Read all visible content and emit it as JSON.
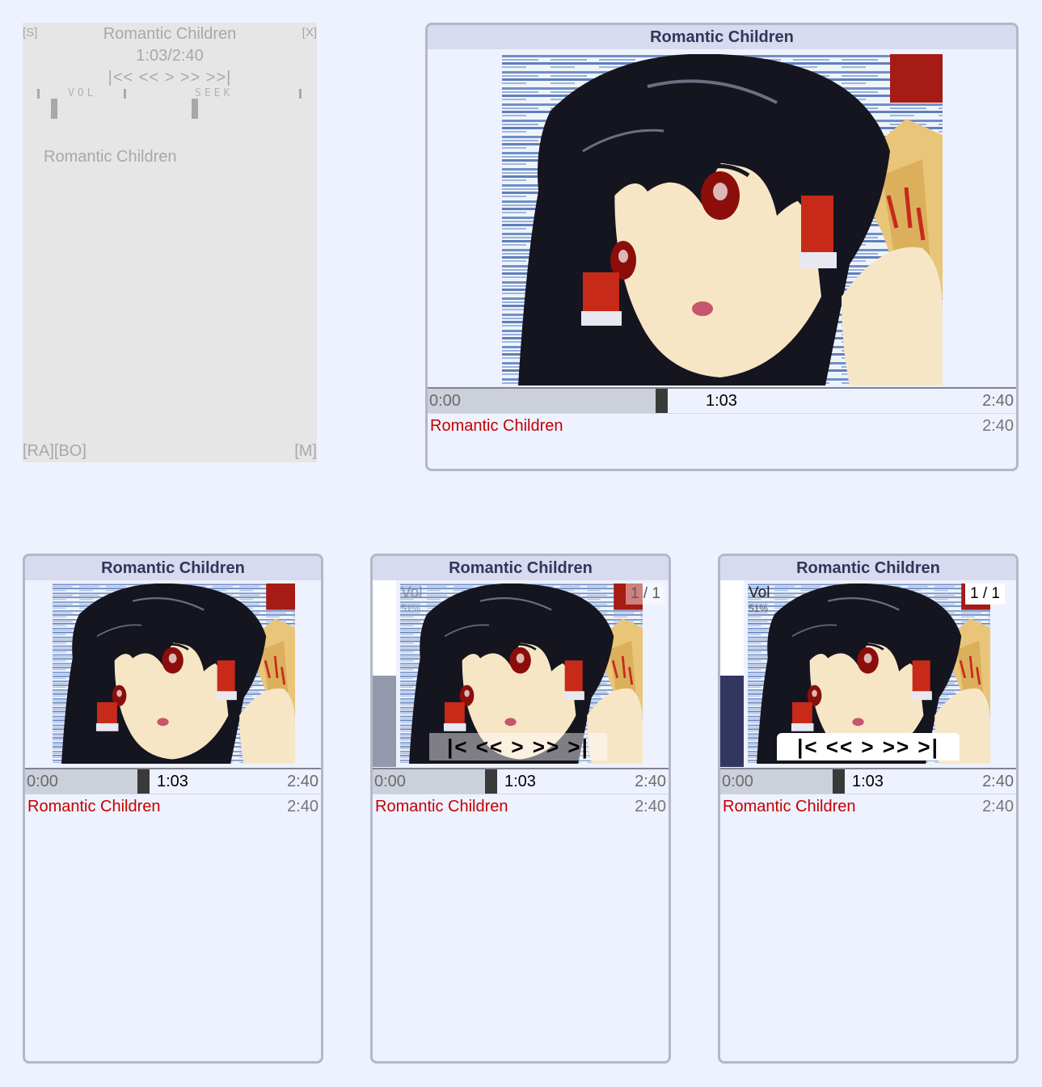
{
  "simple_player": {
    "btn_s": "[S]",
    "btn_x": "[X]",
    "title": "Romantic Children",
    "time": "1:03/2:40",
    "controls": "|<< << > >> >>|",
    "vol_label": "VOL",
    "seek_label": "SEEK",
    "track": "Romantic Children",
    "btn_ra_bo": "[RA][BO]",
    "btn_m": "[M]"
  },
  "players": [
    {
      "title": "Romantic Children",
      "time_start": "0:00",
      "time_current": "1:03",
      "time_end": "2:40",
      "track_name": "Romantic Children",
      "track_duration": "2:40"
    },
    {
      "title": "Romantic Children",
      "time_start": "0:00",
      "time_current": "1:03",
      "time_end": "2:40",
      "track_name": "Romantic Children",
      "track_duration": "2:40"
    },
    {
      "title": "Romantic Children",
      "time_start": "0:00",
      "time_current": "1:03",
      "time_end": "2:40",
      "track_name": "Romantic Children",
      "track_duration": "2:40",
      "volume_label": "Vol",
      "volume_percent": "51%",
      "counter": "1 / 1",
      "controls": "|< << > >> >|"
    },
    {
      "title": "Romantic Children",
      "time_start": "0:00",
      "time_current": "1:03",
      "time_end": "2:40",
      "track_name": "Romantic Children",
      "track_duration": "2:40",
      "volume_label": "Vol",
      "volume_percent": "51%",
      "counter": "1 / 1",
      "controls": "|< << > >> >|"
    }
  ],
  "progress_fraction": 0.39,
  "volume_fraction": 0.51,
  "colors": {
    "page_bg": "#eef1fe",
    "titlebar_bg": "#d8daf0",
    "titlebar_text": "#323659",
    "track_name": "#c40000",
    "volume_fill_light": "#9499ad",
    "volume_fill_dark": "#333660"
  },
  "icons": {
    "cover": "anime-girl-cover-art"
  }
}
